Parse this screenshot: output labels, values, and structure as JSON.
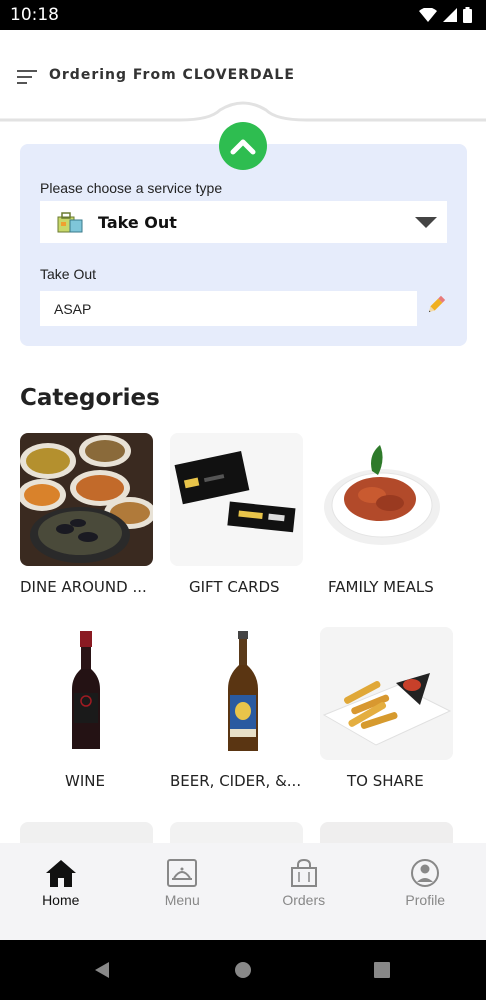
{
  "status_bar": {
    "time": "10:18"
  },
  "header": {
    "title": "Ordering From CLOVERDALE"
  },
  "service": {
    "prompt": "Please choose a service type",
    "selected": "Take Out",
    "time_label": "Take Out",
    "time_value": "ASAP"
  },
  "categories": {
    "title": "Categories",
    "items": [
      {
        "label": "DINE AROUND ..."
      },
      {
        "label": "GIFT CARDS"
      },
      {
        "label": "FAMILY MEALS"
      },
      {
        "label": "WINE"
      },
      {
        "label": "BEER, CIDER, &..."
      },
      {
        "label": "TO SHARE"
      }
    ]
  },
  "bottom_nav": {
    "items": [
      {
        "label": "Home",
        "icon": "home-icon",
        "active": true
      },
      {
        "label": "Menu",
        "icon": "menu-tray-icon",
        "active": false
      },
      {
        "label": "Orders",
        "icon": "shopping-bag-icon",
        "active": false
      },
      {
        "label": "Profile",
        "icon": "profile-icon",
        "active": false
      }
    ]
  },
  "colors": {
    "accent": "#2ebd50",
    "card_bg": "#e6ecfb",
    "nav_bg": "#f4f4f6"
  }
}
